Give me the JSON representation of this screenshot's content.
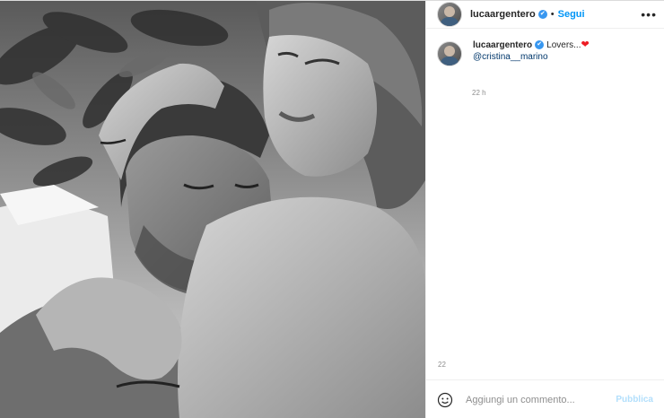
{
  "post": {
    "author": {
      "username": "lucaargentero",
      "verified_icon": "verified-badge-icon",
      "follow_label": "Segui",
      "separator": "•"
    },
    "more_menu_label": "•••",
    "caption": {
      "username": "lucaargentero",
      "text": "Lovers...",
      "heart": "❤",
      "mention": "@cristina__marino",
      "time": "22 h"
    },
    "footer_time": "22",
    "comment": {
      "placeholder": "Aggiungi un commento...",
      "publish_label": "Pubblica"
    },
    "colors": {
      "link": "#0095f6",
      "verified": "#3897f0",
      "heart": "#ed1c24",
      "publish_disabled": "#b2dffc"
    }
  }
}
